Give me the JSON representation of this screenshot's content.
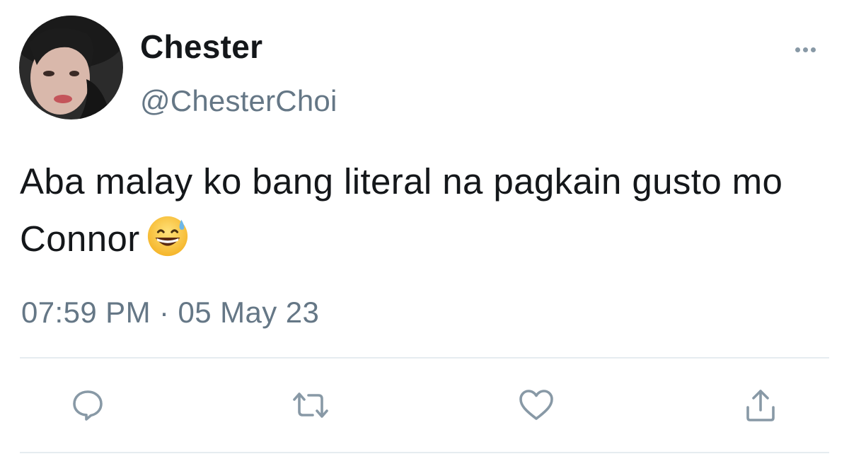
{
  "author": {
    "display_name": "Chester",
    "handle": "@ChesterChoi"
  },
  "tweet": {
    "text": "Aba malay ko bang literal na pagkain gusto mo Connor",
    "emoji": "grinning-face-with-sweat",
    "timestamp": "07:59 PM · 05 May 23"
  },
  "actions": [
    {
      "name": "reply",
      "icon": "speech-bubble-icon"
    },
    {
      "name": "retweet",
      "icon": "retweet-arrows-icon"
    },
    {
      "name": "like",
      "icon": "heart-outline-icon"
    },
    {
      "name": "share",
      "icon": "share-upload-icon"
    }
  ],
  "colors": {
    "text": "#14171a",
    "secondary": "#657786",
    "icon": "#8899a6",
    "divider": "#e6ecf0"
  }
}
